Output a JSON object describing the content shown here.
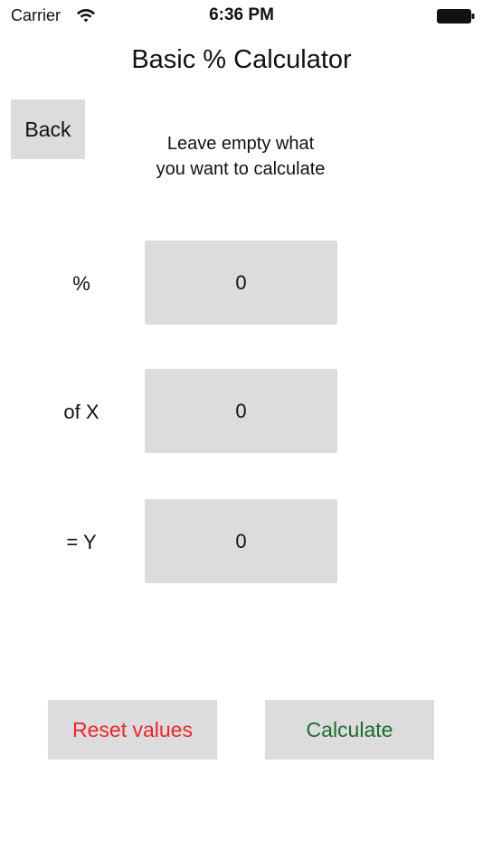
{
  "status_bar": {
    "carrier": "Carrier",
    "time": "6:36 PM",
    "wifi_icon": "wifi-icon",
    "battery_icon": "battery-icon"
  },
  "header": {
    "title": "Basic % Calculator",
    "back_label": "Back"
  },
  "hint": {
    "line1": "Leave empty what",
    "line2": "you want to calculate"
  },
  "fields": {
    "percent": {
      "label": "%",
      "value": "0"
    },
    "of_x": {
      "label": "of X",
      "value": "0"
    },
    "equals_y": {
      "label": "= Y",
      "value": "0"
    }
  },
  "actions": {
    "reset_label": "Reset values",
    "calculate_label": "Calculate"
  },
  "colors": {
    "reset_text": "#e8262a",
    "calculate_text": "#1f6b2a",
    "control_bg": "#dcdcdf"
  }
}
